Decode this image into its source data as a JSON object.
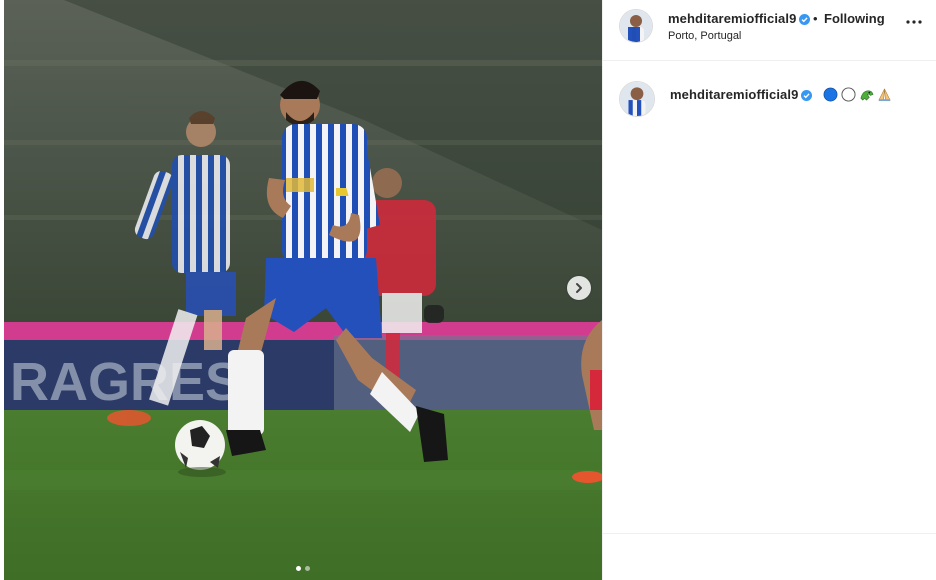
{
  "post": {
    "username": "mehditaremiofficial9",
    "separator": "•",
    "follow_status": "Following",
    "location": "Porto, Portugal"
  },
  "caption": {
    "username": "mehditaremiofficial9",
    "emojis": [
      "blue-circle",
      "white-circle",
      "dragon",
      "folded-hands"
    ]
  },
  "carousel": {
    "slide_count": 2,
    "active_index": 0
  },
  "icons": {
    "verified": "verified-badge-icon",
    "more": "more-options-icon",
    "next": "chevron-right-icon"
  },
  "colors": {
    "verified_blue": "#3897f0",
    "text": "#262626",
    "border": "#efefef"
  }
}
